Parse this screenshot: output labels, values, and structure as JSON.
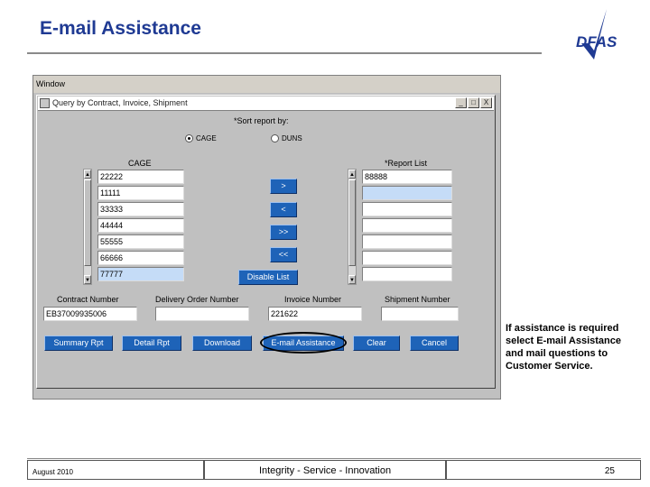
{
  "slide": {
    "title": "E-mail Assistance",
    "logo_text": "DFAS",
    "note": "If assistance is required select E-mail Assistance and mail questions to Customer Service.",
    "footer": {
      "date": "August 2010",
      "tagline": "Integrity - Service - Innovation",
      "page": "25"
    }
  },
  "app": {
    "menubar": "Window",
    "form_title": "Query by Contract, Invoice, Shipment",
    "window_buttons": [
      "_",
      "□",
      "X"
    ],
    "sort_label": "*Sort report by:",
    "sort_options": [
      {
        "label": "CAGE",
        "selected": true
      },
      {
        "label": "DUNS",
        "selected": false
      }
    ],
    "cage_header": "CAGE",
    "cage_list": [
      "22222",
      "11111",
      "33333",
      "44444",
      "55555",
      "66666",
      "77777"
    ],
    "report_header": "*Report List",
    "report_list": [
      "88888",
      "",
      "",
      "",
      "",
      "",
      ""
    ],
    "move_buttons": [
      ">",
      "<",
      ">>",
      "<<"
    ],
    "disable_list": "Disable List",
    "contract_label": "Contract Number",
    "contract_value": "EB37009935006",
    "delivery_label": "Delivery Order Number",
    "delivery_value": "",
    "invoice_label": "Invoice Number",
    "invoice_value": "221622",
    "shipment_label": "Shipment Number",
    "shipment_value": "",
    "actions": [
      "Summary Rpt",
      "Detail Rpt",
      "Download",
      "E-mail Assistance",
      "Clear",
      "Cancel"
    ]
  },
  "colors": {
    "title": "#1f3a93",
    "button": "#1e63b8",
    "selected_field": "#c5dcf7"
  }
}
